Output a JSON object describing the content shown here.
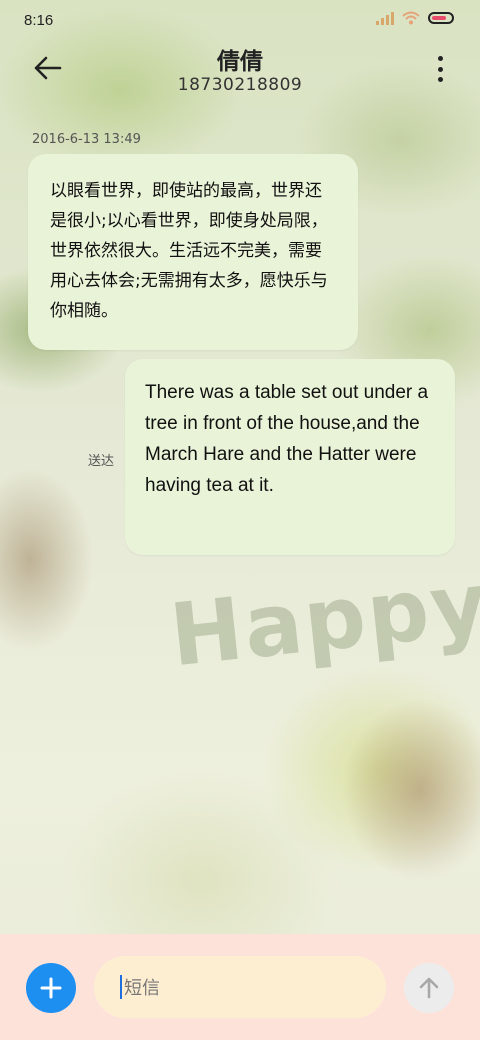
{
  "status_bar": {
    "time": "8:16"
  },
  "header": {
    "contact_name": "倩倩",
    "phone_number": "18730218809"
  },
  "conversation": {
    "timestamp": "2016-6-13 13:49",
    "messages": [
      {
        "direction": "incoming",
        "text": "以眼看世界，即使站的最高，世界还是很小;以心看世界，即使身处局限，世界依然很大。生活远不完美，需要用心去体会;无需拥有太多，愿快乐与你相随。"
      },
      {
        "direction": "outgoing",
        "text": "There was a table set out under a tree in front of the house,and the March Hare and the Hatter were having tea at it.",
        "status": "送达"
      }
    ]
  },
  "composer": {
    "placeholder": "短信"
  },
  "background": {
    "wallpaper_text": "Happy"
  },
  "colors": {
    "bubble": "#e9f3d8",
    "add_button": "#1d8ff0",
    "bottom_bar": "#fde2da",
    "input_bg": "#fdeed1"
  },
  "icons": [
    "back-arrow-icon",
    "more-vert-icon",
    "plus-icon",
    "send-arrow-icon",
    "signal-icon",
    "wifi-icon",
    "battery-icon"
  ]
}
